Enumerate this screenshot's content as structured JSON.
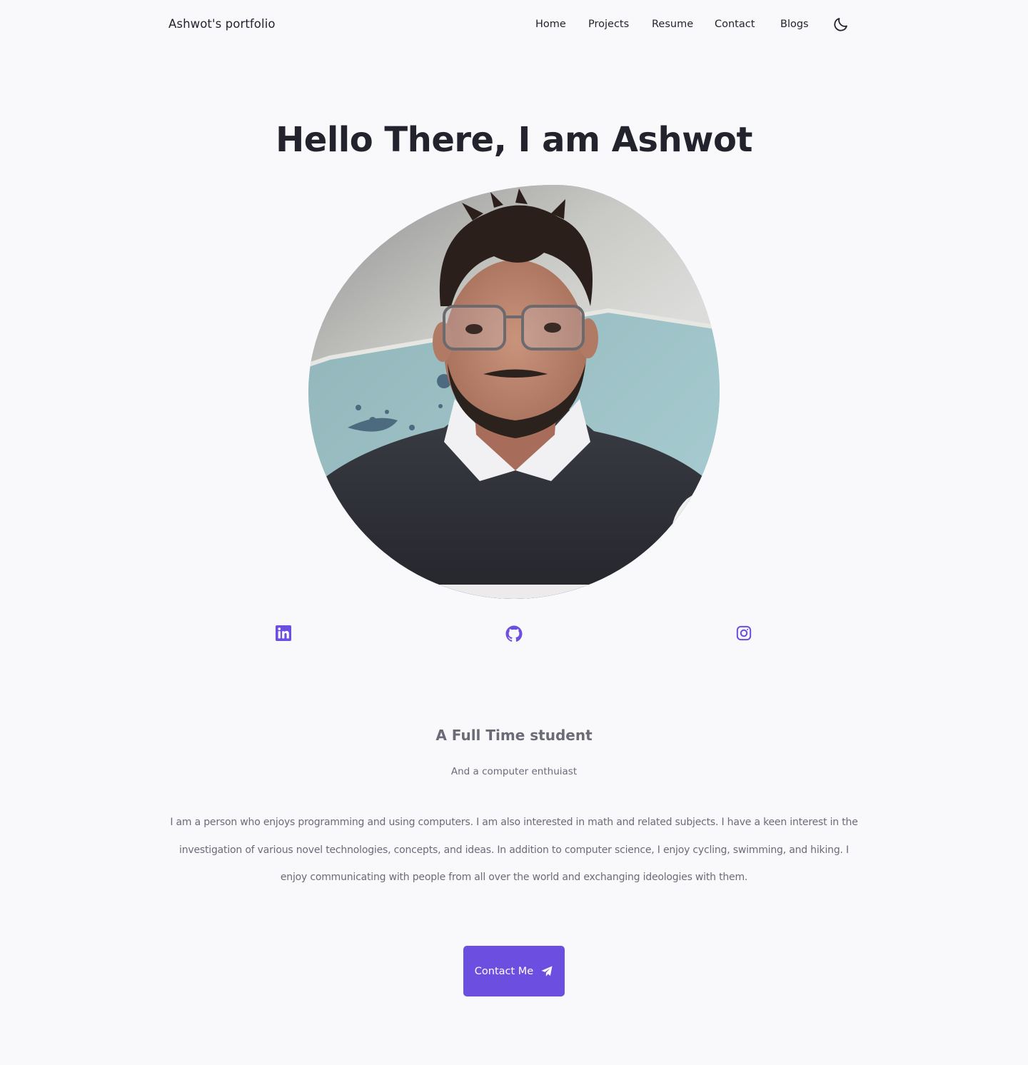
{
  "header": {
    "logo": "Ashwot's portfolio",
    "nav": [
      "Home",
      "Projects",
      "Resume",
      "Contact",
      "Blogs"
    ],
    "theme_toggle_icon": "moon-icon"
  },
  "hero": {
    "title": "Hello There, I am Ashwot",
    "avatar_alt": "avatar"
  },
  "socials": [
    {
      "name": "linkedin-icon"
    },
    {
      "name": "github-icon"
    },
    {
      "name": "instagram-icon"
    }
  ],
  "about": {
    "subtitle": "A Full Time student",
    "tagline": "And a computer enthuiast",
    "bio": "I am a person who enjoys programming and using computers. I am also interested in math and related subjects. I have a keen interest in the investigation of various novel technologies, concepts, and ideas. In addition to computer science, I enjoy cycling, swimming, and hiking. I enjoy communicating with people from all over the world and exchanging ideologies with them."
  },
  "cta": {
    "label": "Contact Me",
    "icon": "send-icon"
  },
  "colors": {
    "background": "#f9f9fc",
    "accent": "#6c4fe0",
    "text": "#23232d",
    "muted": "#6b6b78"
  }
}
